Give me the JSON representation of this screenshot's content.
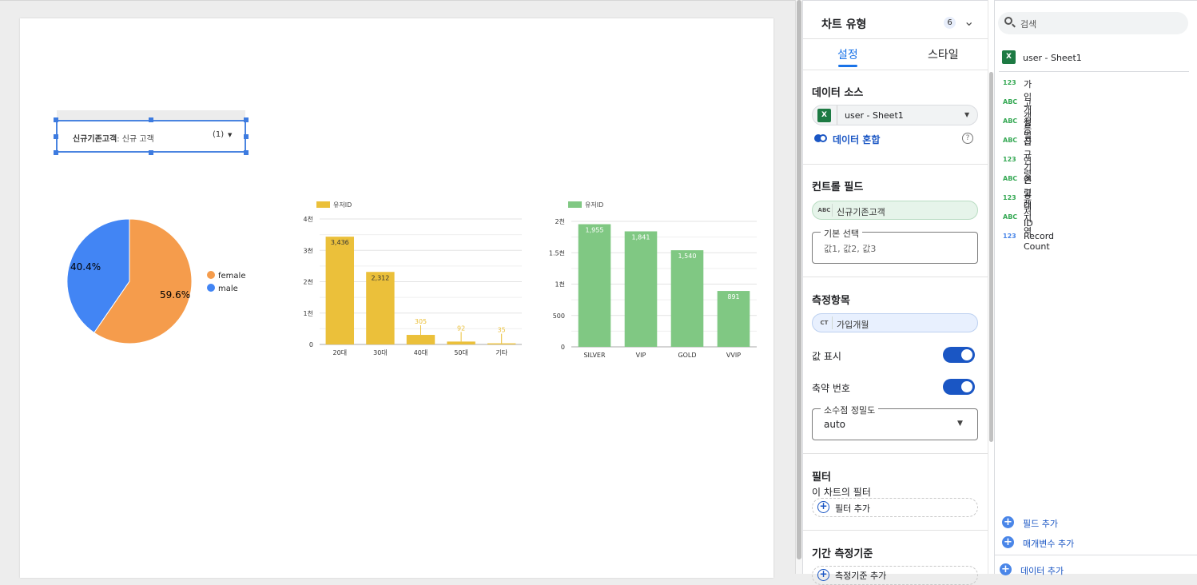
{
  "control": {
    "field": "신규기존고객",
    "value": ": 신규 고객",
    "count": "(1)"
  },
  "pie": {
    "slices": [
      {
        "label": "female",
        "value": 59.6,
        "pct": "59.6%",
        "color": "#f59c4c"
      },
      {
        "label": "male",
        "value": 40.4,
        "pct": "40.4%",
        "color": "#4285f4"
      }
    ]
  },
  "chart_data": [
    {
      "type": "bar",
      "title": "",
      "legend": "유저ID",
      "color": "#ebc03a",
      "categories": [
        "20대",
        "30대",
        "40대",
        "50대",
        "기타"
      ],
      "values": [
        3436,
        2312,
        305,
        92,
        35
      ],
      "value_labels": [
        "3,436",
        "2,312",
        "305",
        "92",
        "35"
      ],
      "ylim": [
        0,
        4000
      ],
      "yticks": [
        "0",
        "1천",
        "2천",
        "3천",
        "4천"
      ],
      "grid": true,
      "legend_position": "top-left"
    },
    {
      "type": "bar",
      "title": "",
      "legend": "유저ID",
      "color": "#80c883",
      "categories": [
        "SILVER",
        "VIP",
        "GOLD",
        "VVIP"
      ],
      "values": [
        1955,
        1841,
        1540,
        891
      ],
      "value_labels": [
        "1,955",
        "1,841",
        "1,540",
        "891"
      ],
      "ylim": [
        0,
        2000
      ],
      "yticks": [
        "0",
        "500",
        "1천",
        "1.5천",
        "2천"
      ],
      "grid": true,
      "legend_position": "top-left"
    }
  ],
  "panel": {
    "chart_type_label": "차트 유형",
    "chart_type_badge": "6",
    "tabs": [
      "설정",
      "스타일"
    ],
    "data_source": {
      "title": "데이터 소스",
      "name": "user - Sheet1",
      "blend": "데이터 혼합"
    },
    "control_field": {
      "title": "컨트롤 필드",
      "type": "ABC",
      "name": "신규기존고객"
    },
    "default_select": {
      "legend": "기본 선택",
      "placeholder": "값1, 값2, 값3"
    },
    "metric": {
      "title": "측정항목",
      "type": "CT",
      "name": "가입개월"
    },
    "show_values": "값 표시",
    "abbrev": "축약 번호",
    "decimal": {
      "legend": "소수점 정밀도",
      "value": "auto"
    },
    "filter": {
      "title": "필터",
      "sub": "이 차트의 필터",
      "add": "필터 추가"
    },
    "period": {
      "title": "기간 측정기준",
      "add": "측정기준 추가"
    }
  },
  "fields": {
    "search_placeholder": "검색",
    "source": "user - Sheet1",
    "items": [
      {
        "type": "123",
        "name": "가입개월"
      },
      {
        "type": "ABC",
        "name": "고객등급"
      },
      {
        "type": "ABC",
        "name": "성별"
      },
      {
        "type": "ABC",
        "name": "신규기존고객"
      },
      {
        "type": "123",
        "name": "연령"
      },
      {
        "type": "ABC",
        "name": "연령대"
      },
      {
        "type": "123",
        "name": "유저ID"
      },
      {
        "type": "ABC",
        "name": "지역"
      },
      {
        "type": "123",
        "name": "Record Count"
      }
    ],
    "add_field": "필드 추가",
    "add_param": "매개변수 추가",
    "add_data": "데이터 추가"
  }
}
